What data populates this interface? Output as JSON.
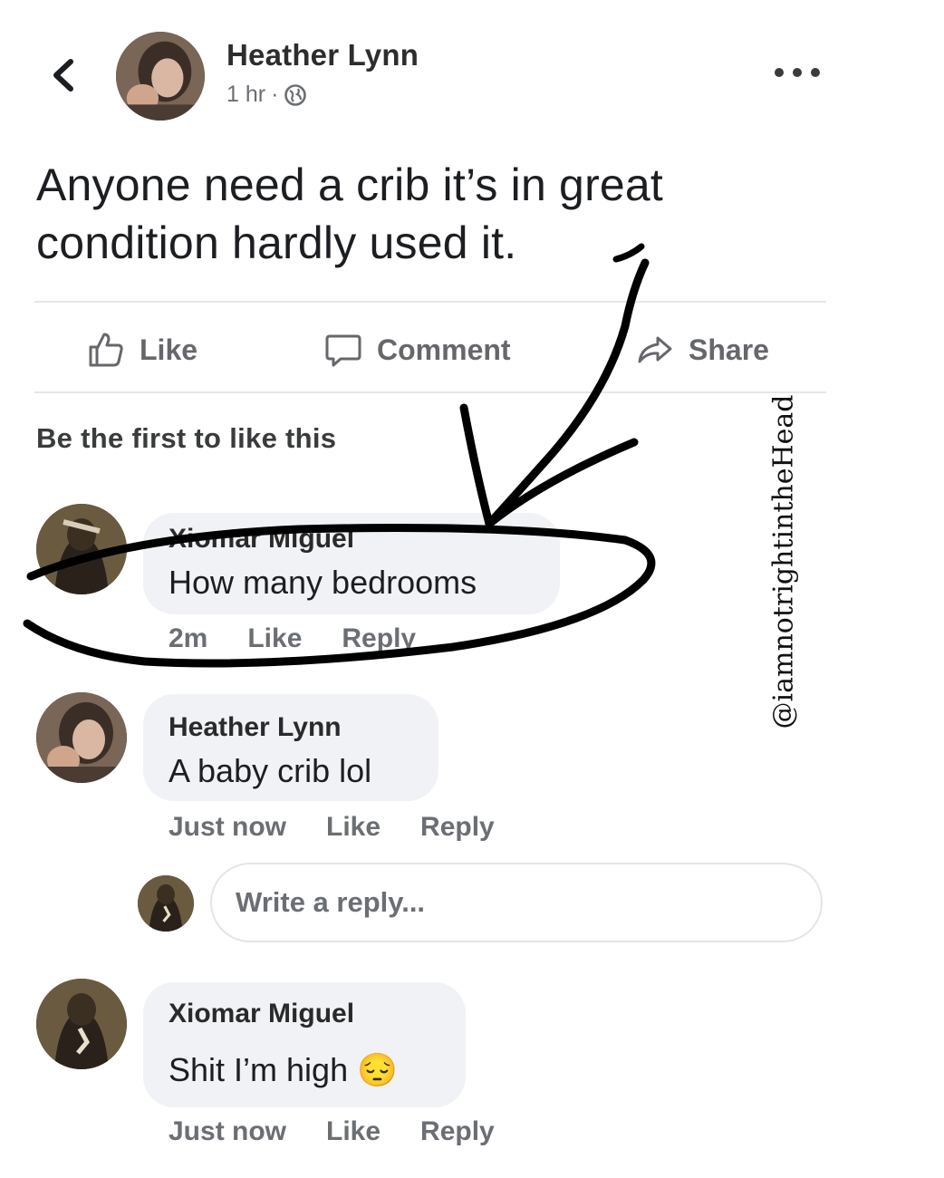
{
  "post": {
    "author": "Heather Lynn",
    "time": "1 hr",
    "separator": "·",
    "text": "Anyone need a crib it’s in great condition hardly used it."
  },
  "actions": {
    "like": "Like",
    "comment": "Comment",
    "share": "Share"
  },
  "reactions_summary": "Be the first to like this",
  "comments": [
    {
      "author": "Xiomar Miguel",
      "text": "How many bedrooms",
      "time": "2m",
      "like": "Like",
      "reply": "Reply"
    },
    {
      "author": "Heather Lynn",
      "text": "A baby crib lol",
      "time": "Just now",
      "like": "Like",
      "reply": "Reply"
    },
    {
      "author": "Xiomar Miguel",
      "text": "Shit I’m high",
      "emoji": "😔",
      "time": "Just now",
      "like": "Like",
      "reply": "Reply"
    }
  ],
  "reply_input": {
    "placeholder": "Write a reply..."
  },
  "watermark": "@iamnotrightintheHead",
  "icons": [
    "chevron-left-icon",
    "globe-icon",
    "more-icon",
    "thumbs-up-icon",
    "comment-icon",
    "share-arrow-icon",
    "pensive-face-emoji"
  ],
  "colors": {
    "meta_gray": "#65676b",
    "bubble": "#f0f2f5",
    "divider": "#e4e6eb",
    "ink": "#000000"
  }
}
